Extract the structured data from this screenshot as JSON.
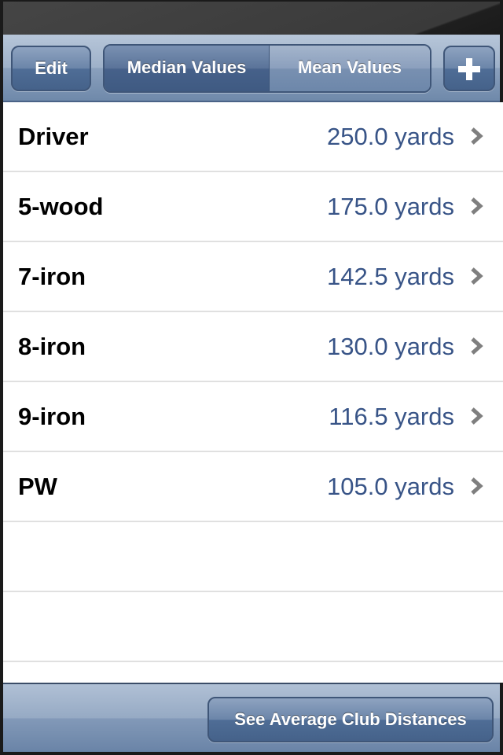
{
  "navbar": {
    "edit_label": "Edit",
    "segments": [
      {
        "label": "Median Values",
        "selected": true
      },
      {
        "label": "Mean Values",
        "selected": false
      }
    ],
    "add_icon": "plus-icon",
    "add_label": "+"
  },
  "clubs": [
    {
      "name": "Driver",
      "value": "250.0 yards"
    },
    {
      "name": "5-wood",
      "value": "175.0 yards"
    },
    {
      "name": "7-iron",
      "value": "142.5 yards"
    },
    {
      "name": "8-iron",
      "value": "130.0 yards"
    },
    {
      "name": "9-iron",
      "value": "116.5 yards"
    },
    {
      "name": "PW",
      "value": "105.0 yards"
    }
  ],
  "row_accessory_icon": "chevron-right-icon",
  "toolbar": {
    "average_button_label": "See Average Club Distances"
  },
  "colors": {
    "value_text": "#385487",
    "bar_tint": "#6f89aa"
  }
}
